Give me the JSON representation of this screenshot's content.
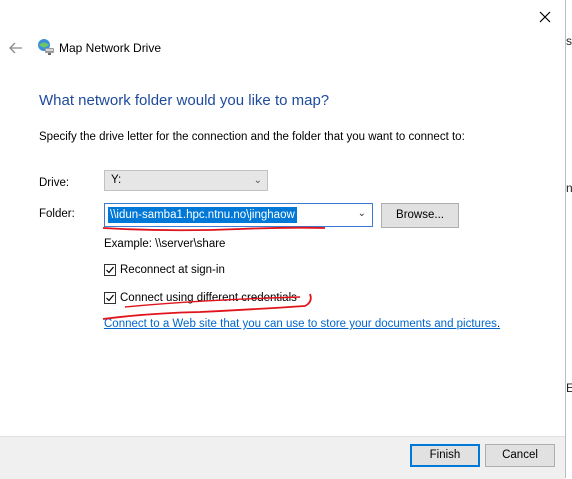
{
  "window": {
    "title": "Map Network Drive",
    "close_icon": "close-icon",
    "back_icon": "back-arrow-icon",
    "app_icon": "network-drive-icon"
  },
  "main": {
    "heading": "What network folder would you like to map?",
    "instruction": "Specify the drive letter for the connection and the folder that you want to connect to:",
    "drive_label": "Drive:",
    "drive_value": "Y:",
    "folder_label": "Folder:",
    "folder_value": "\\\\idun-samba1.hpc.ntnu.no\\jinghaow",
    "browse_label": "Browse...",
    "example": "Example: \\\\server\\share",
    "reconnect_label": "Reconnect at sign-in",
    "reconnect_checked": true,
    "credentials_label": "Connect using different credentials",
    "credentials_checked": true,
    "link_text": "Connect to a Web site that you can use to store your documents and pictures",
    "link_suffix": "."
  },
  "footer": {
    "finish_label": "Finish",
    "cancel_label": "Cancel"
  },
  "background": {
    "char_1": "s",
    "char_2": "n",
    "char_3": "E"
  },
  "colors": {
    "heading": "#1e4a9e",
    "link": "#0066cc",
    "selection": "#0078d7",
    "annotation": "#e0141b"
  }
}
